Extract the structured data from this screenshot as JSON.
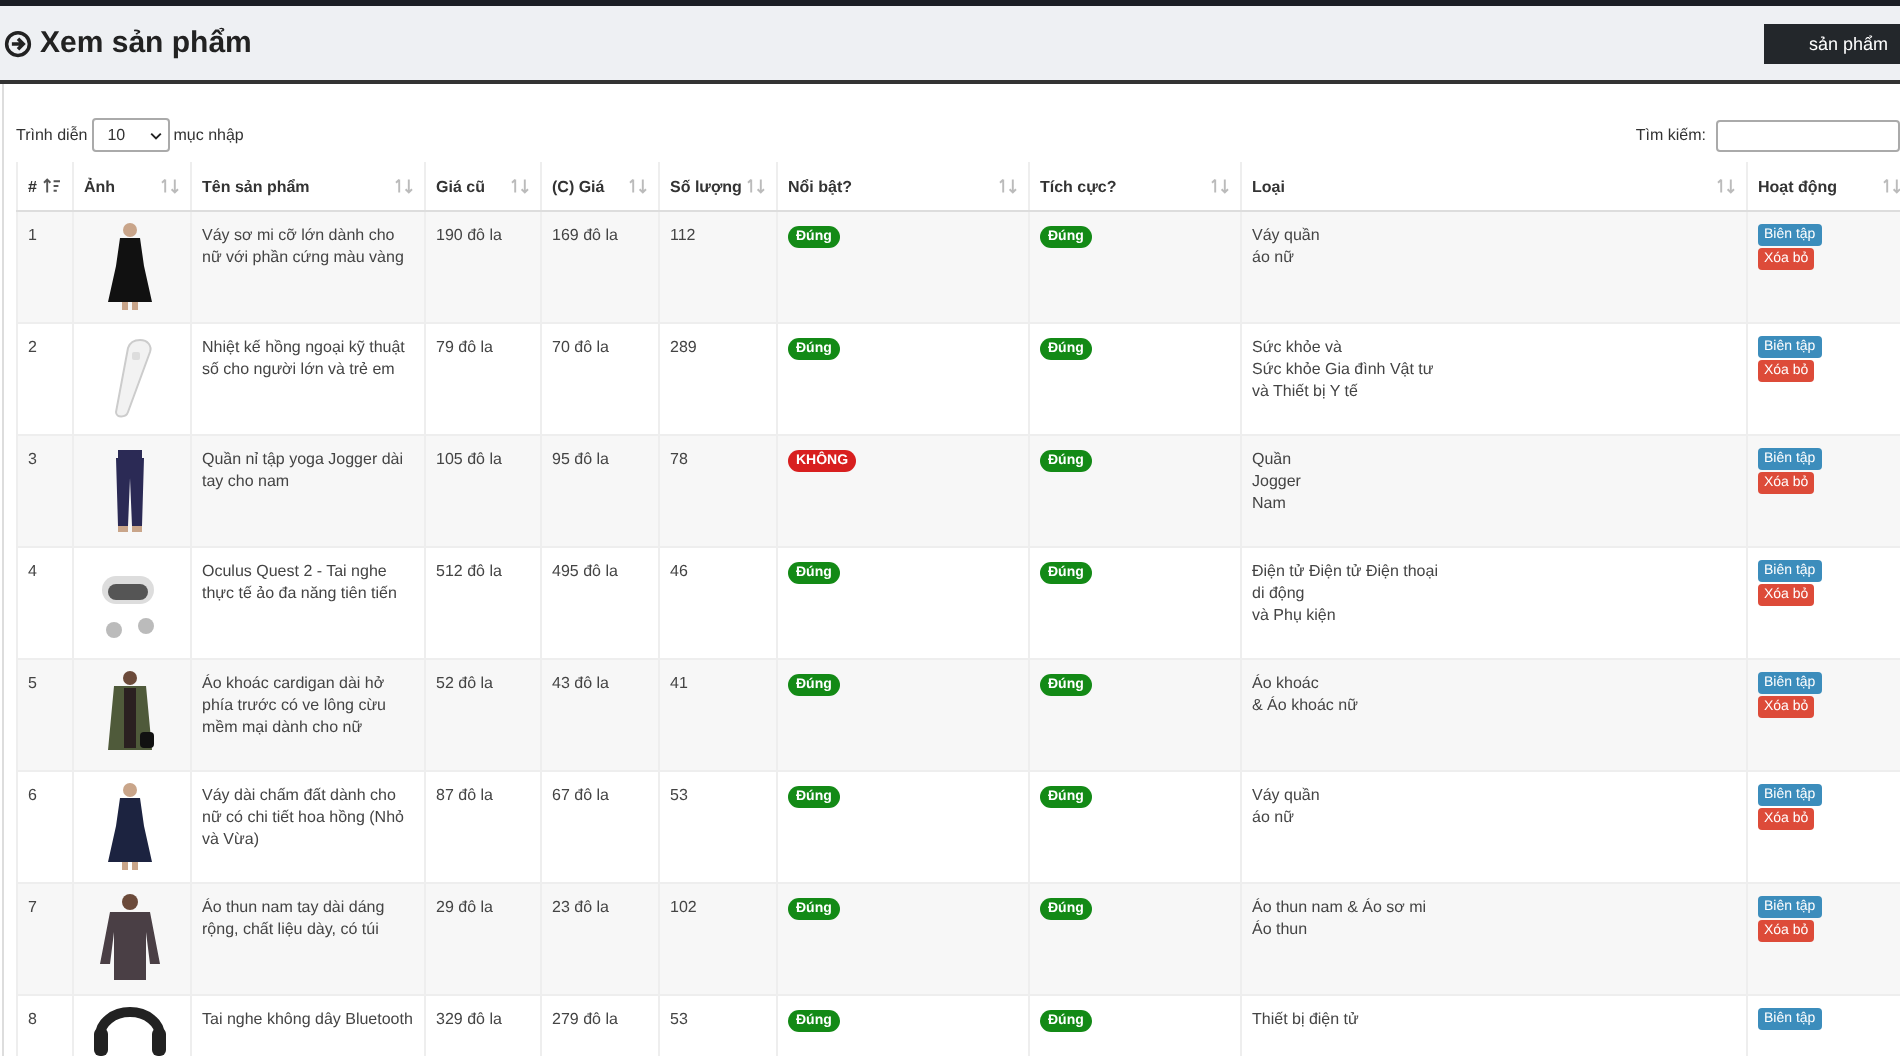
{
  "header": {
    "title": "Xem sản phẩm",
    "add_button": "sản phẩm"
  },
  "controls": {
    "length_prefix": "Trình diễn",
    "length_value": "10",
    "length_suffix": "mục nhập",
    "search_label": "Tìm kiếm:"
  },
  "table": {
    "columns": [
      {
        "label": "#",
        "kind": "sorted"
      },
      {
        "label": "Ảnh",
        "kind": "sortable"
      },
      {
        "label": "Tên sản phẩm",
        "kind": "sortable"
      },
      {
        "label": "Giá cũ",
        "kind": "sortable"
      },
      {
        "label": "(C) Giá",
        "kind": "sortable"
      },
      {
        "label": "Số lượng",
        "kind": "sortable"
      },
      {
        "label": "Nổi bật?",
        "kind": "sortable"
      },
      {
        "label": "Tích cực?",
        "kind": "sortable"
      },
      {
        "label": "Loại",
        "kind": "sortable"
      },
      {
        "label": "Hoạt động",
        "kind": "sortable"
      }
    ],
    "rows": [
      {
        "num": "1",
        "image": {
          "kind": "picture"
        },
        "name": "Váy sơ mi cỡ lớn dành cho nữ với phần cứng màu vàng",
        "old_price": "190 đô la",
        "price": "169 đô la",
        "qty": "112",
        "featured": {
          "label": "Đúng",
          "value": true
        },
        "active": {
          "label": "Đúng",
          "value": true
        },
        "category": [
          "Váy quần",
          "áo nữ"
        ],
        "edit": "Biên tập",
        "delete": "Xóa bỏ"
      },
      {
        "num": "2",
        "image": {
          "kind": "picture"
        },
        "name": "Nhiệt kế hồng ngoại kỹ thuật số cho người lớn và trẻ em",
        "old_price": "79 đô la",
        "price": "70 đô la",
        "qty": "289",
        "featured": {
          "label": "Đúng",
          "value": true
        },
        "active": {
          "label": "Đúng",
          "value": true
        },
        "category": [
          "Sức khỏe và",
          "Sức khỏe Gia đình Vật tư",
          "và Thiết bị Y tế"
        ],
        "edit": "Biên tập",
        "delete": "Xóa bỏ"
      },
      {
        "num": "3",
        "image": {
          "kind": "picture"
        },
        "name": "Quần nỉ tập yoga Jogger dài tay cho nam",
        "old_price": "105 đô la",
        "price": "95 đô la",
        "qty": "78",
        "featured": {
          "label": "KHÔNG",
          "value": false
        },
        "active": {
          "label": "Đúng",
          "value": true
        },
        "category": [
          "Quần",
          "Jogger",
          "Nam"
        ],
        "edit": "Biên tập",
        "delete": "Xóa bỏ"
      },
      {
        "num": "4",
        "image": {
          "kind": "picture"
        },
        "name": "Oculus Quest 2 - Tai nghe thực tế ảo đa năng tiên tiến",
        "old_price": "512 đô la",
        "price": "495 đô la",
        "qty": "46",
        "featured": {
          "label": "Đúng",
          "value": true
        },
        "active": {
          "label": "Đúng",
          "value": true
        },
        "category": [
          "Điện tử Điện tử Điện thoại",
          "di động",
          "và Phụ kiện"
        ],
        "edit": "Biên tập",
        "delete": "Xóa bỏ"
      },
      {
        "num": "5",
        "image": {
          "kind": "picture"
        },
        "name": "Áo khoác cardigan dài hở phía trước có ve lông cừu mềm mại dành cho nữ",
        "old_price": "52 đô la",
        "price": "43 đô la",
        "qty": "41",
        "featured": {
          "label": "Đúng",
          "value": true
        },
        "active": {
          "label": "Đúng",
          "value": true
        },
        "category": [
          "Áo khoác",
          "& Áo khoác nữ"
        ],
        "edit": "Biên tập",
        "delete": "Xóa bỏ"
      },
      {
        "num": "6",
        "image": {
          "kind": "picture"
        },
        "name": "Váy dài chấm đất dành cho nữ có chi tiết hoa hồng (Nhỏ và Vừa)",
        "old_price": "87 đô la",
        "price": "67 đô la",
        "qty": "53",
        "featured": {
          "label": "Đúng",
          "value": true
        },
        "active": {
          "label": "Đúng",
          "value": true
        },
        "category": [
          "Váy quần",
          "áo nữ"
        ],
        "edit": "Biên tập",
        "delete": "Xóa bỏ"
      },
      {
        "num": "7",
        "image": {
          "kind": "picture"
        },
        "name": "Áo thun nam tay dài dáng rộng, chất liệu dày, có túi",
        "old_price": "29 đô la",
        "price": "23 đô la",
        "qty": "102",
        "featured": {
          "label": "Đúng",
          "value": true
        },
        "active": {
          "label": "Đúng",
          "value": true
        },
        "category": [
          "Áo thun nam & Áo sơ mi",
          "Áo thun"
        ],
        "edit": "Biên tập",
        "delete": "Xóa bỏ"
      },
      {
        "num": "8",
        "image": {
          "kind": "picture"
        },
        "name": "Tai nghe không dây Bluetooth",
        "old_price": "329 đô la",
        "price": "279 đô la",
        "qty": "53",
        "featured": {
          "label": "Đúng",
          "value": true
        },
        "active": {
          "label": "Đúng",
          "value": true
        },
        "category": [
          "Thiết bị điện tử"
        ],
        "edit": "Biên tập"
      }
    ]
  }
}
